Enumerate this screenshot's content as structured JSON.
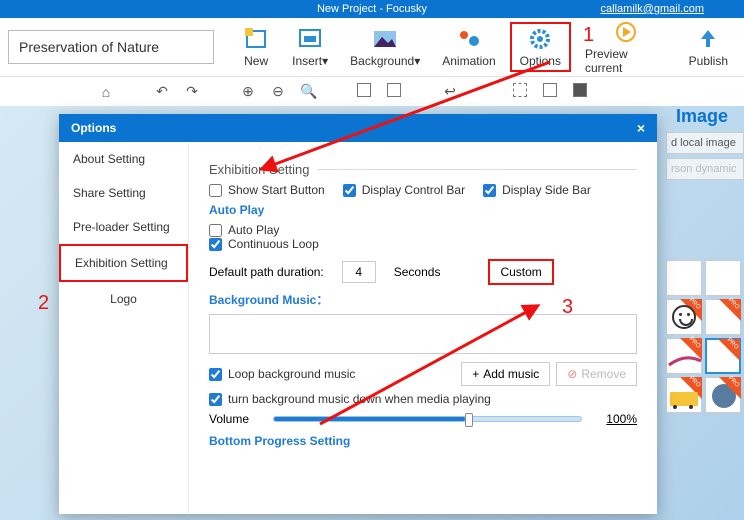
{
  "title": "New Project - Focusky",
  "email": "callamilk@gmail.com",
  "project_name": "Preservation of Nature",
  "ribbon": {
    "new": "New",
    "insert": "Insert",
    "background": "Background",
    "animation": "Animation",
    "options": "Options",
    "preview": "Preview current",
    "publish": "Publish"
  },
  "callouts": {
    "one": "1",
    "two": "2",
    "three": "3"
  },
  "side_panel": {
    "title": "Image",
    "local": "d local image",
    "dynamic": "rson dynamic"
  },
  "dialog": {
    "title": "Options",
    "close": "×",
    "tabs": {
      "about": "About Setting",
      "share": "Share Setting",
      "preloader": "Pre-loader Setting",
      "exhibition": "Exhibition Setting",
      "logo": "Logo"
    },
    "exhibition": {
      "heading": "Exhibition Setting",
      "show_start": "Show Start Button",
      "display_ctrl": "Display Control Bar",
      "display_side": "Display Side Bar",
      "autoplay_h": "Auto Play",
      "autoplay": "Auto Play",
      "loop": "Continuous Loop",
      "duration_label": "Default path duration:",
      "duration_value": "4",
      "seconds": "Seconds",
      "custom": "Custom",
      "bgm_h": "Background Music：",
      "loop_music": "Loop background music",
      "add_music": "Add music",
      "remove": "Remove",
      "turn_down": "turn background music down when media playing",
      "volume": "Volume",
      "vol_pct": "100%",
      "bottom_h": "Bottom Progress Setting"
    }
  }
}
